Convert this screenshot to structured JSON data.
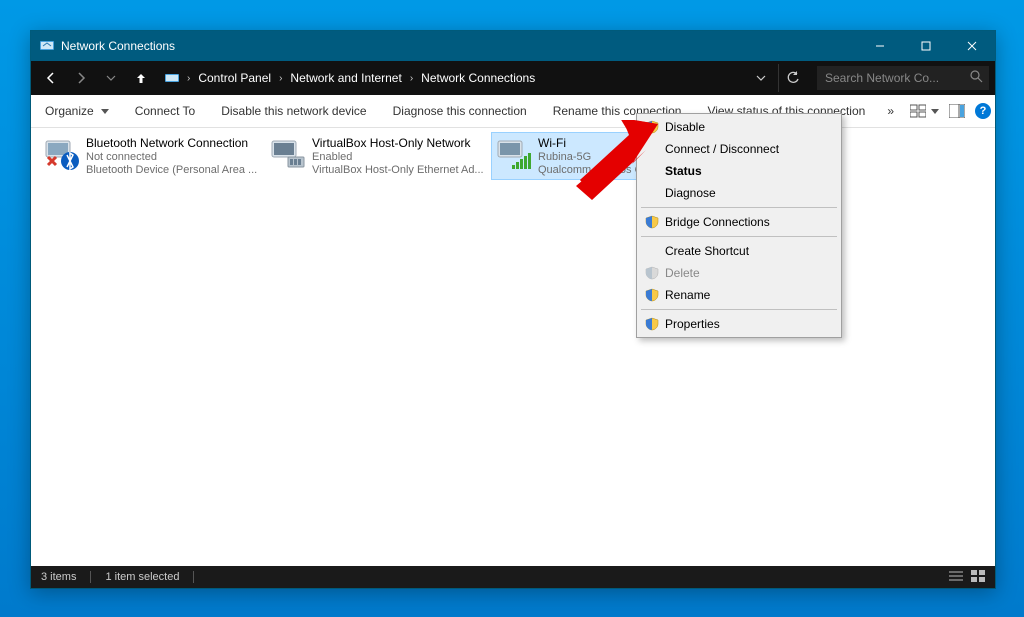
{
  "window": {
    "title": "Network Connections"
  },
  "breadcrumb": {
    "segments": [
      "Control Panel",
      "Network and Internet",
      "Network Connections"
    ]
  },
  "search": {
    "placeholder": "Search Network Co..."
  },
  "commands": {
    "organize": "Organize",
    "connect_to": "Connect To",
    "disable": "Disable this network device",
    "diagnose": "Diagnose this connection",
    "rename": "Rename this connection",
    "view_status": "View status of this connection"
  },
  "items": [
    {
      "name": "Bluetooth Network Connection",
      "status": "Not connected",
      "device": "Bluetooth Device (Personal Area ..."
    },
    {
      "name": "VirtualBox Host-Only Network",
      "status": "Enabled",
      "device": "VirtualBox Host-Only Ethernet Ad..."
    },
    {
      "name": "Wi-Fi",
      "status": "Rubina-5G",
      "device": "Qualcomm Atheros Q..."
    }
  ],
  "context_menu": {
    "disable": "Disable",
    "connect_disconnect": "Connect / Disconnect",
    "status": "Status",
    "diagnose": "Diagnose",
    "bridge": "Bridge Connections",
    "create_shortcut": "Create Shortcut",
    "delete": "Delete",
    "rename": "Rename",
    "properties": "Properties"
  },
  "statusbar": {
    "items_count": "3 items",
    "selected": "1 item selected"
  }
}
